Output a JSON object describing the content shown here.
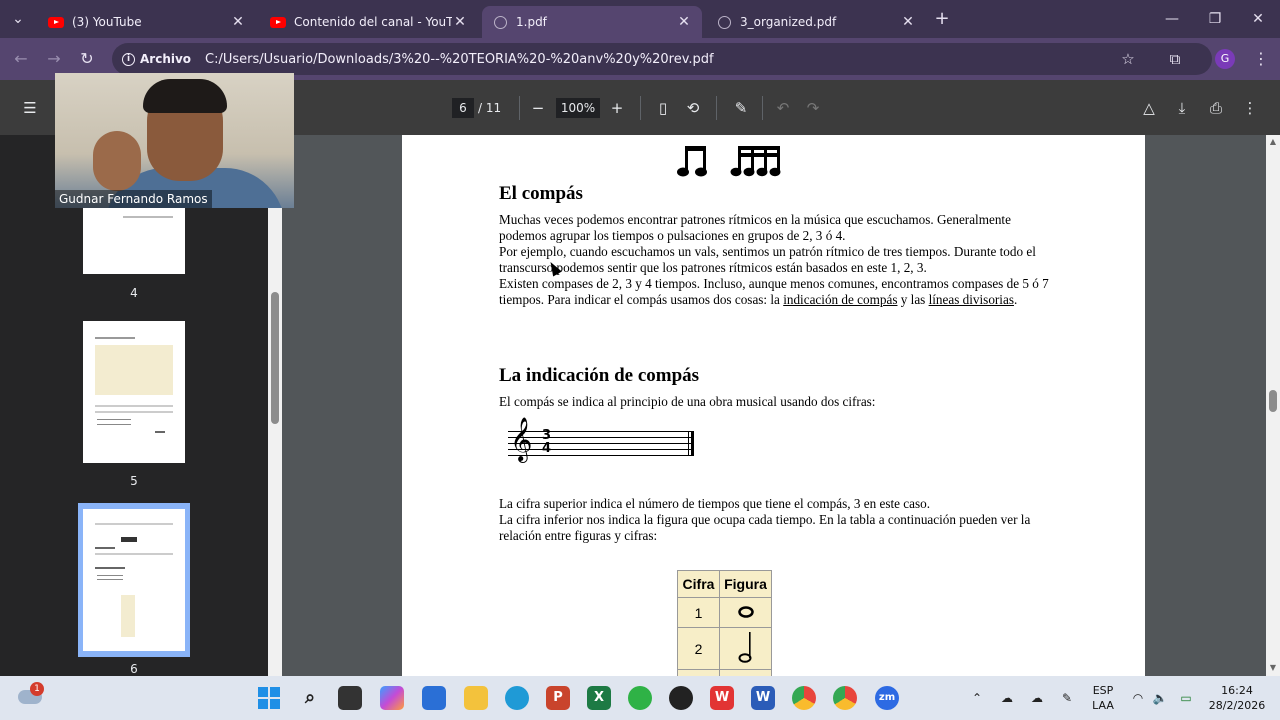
{
  "browser": {
    "tabs": [
      {
        "title": "(3) YouTube",
        "icon": "youtube-icon",
        "active": false
      },
      {
        "title": "Contenido del canal - YouTube",
        "icon": "youtube-icon",
        "active": false
      },
      {
        "title": "1.pdf",
        "icon": "globe-icon",
        "active": true
      },
      {
        "title": "3_organized.pdf",
        "icon": "globe-icon",
        "active": false
      }
    ],
    "chip_label": "Archivo",
    "url": "C:/Users/Usuario/Downloads/3%20--%20TEORIA%20-%20anv%20y%20rev.pdf",
    "profile_initial": "G"
  },
  "pdf_toolbar": {
    "current_page": "6",
    "total_pages": "/ 11",
    "zoom": "100%"
  },
  "sidebar": {
    "thumbnails": [
      {
        "label": "4"
      },
      {
        "label": "5"
      },
      {
        "label": "6"
      }
    ]
  },
  "webcam": {
    "participant_name": "Gudnar Fernando Ramos"
  },
  "document": {
    "section1_title": "El compás",
    "section1_paragraph1": "Muchas veces podemos encontrar patrones rítmicos en la música que escuchamos. Generalmente podemos agrupar los tiempos o pulsaciones en grupos de 2, 3 ó 4.",
    "section1_paragraph2": "Por ejemplo, cuando escuchamos un vals, sentimos un patrón rítmico de tres tiempos. Durante todo el transcurso podemos sentir que los patrones rítmicos están basados en este 1, 2, 3.",
    "section1_paragraph3_part1": "Existen compases de 2, 3 y 4 tiempos. Incluso, aunque menos comunes, encontramos compases de 5 ó 7 tiempos. Para indicar el compás usamos dos cosas: la ",
    "section1_link1": "indicación de compás",
    "section1_paragraph3_part2": " y las ",
    "section1_link2": "líneas divisorias",
    "section1_paragraph3_end": ".",
    "section2_title": "La indicación de compás",
    "section2_intro": "El compás se indica al principio de una obra musical usando dos cifras:",
    "time_sig_top": "3",
    "time_sig_bottom": "4",
    "section2_paragraph1": "La cifra superior indica el número de tiempos que tiene el compás, 3 en este caso.",
    "section2_paragraph2": "La cifra inferior nos indica la figura que ocupa cada tiempo. En la tabla a continuación pueden ver la relación entre figuras y cifras:",
    "table": {
      "headers": [
        "Cifra",
        "Figura"
      ],
      "rows": [
        {
          "cifra": "1",
          "figura_icon": "whole-note-icon"
        },
        {
          "cifra": "2",
          "figura_icon": "half-note-icon"
        }
      ]
    }
  },
  "taskbar": {
    "weather_badge": "1",
    "language_line1": "ESP",
    "language_line2": "LAA",
    "time": "16:24",
    "date": "28/2/2026"
  },
  "colors": {
    "tabstrip": "#3c3350",
    "active_tab": "#55456f",
    "pdf_toolbar": "#3c3c3c",
    "table_cell": "#f7eec8"
  }
}
